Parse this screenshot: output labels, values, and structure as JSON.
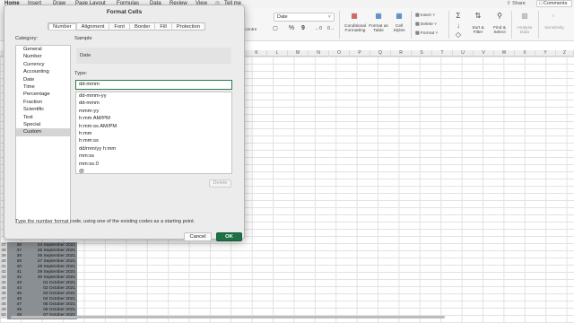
{
  "ribbon_tabs": [
    "Home",
    "Insert",
    "Draw",
    "Page Layout",
    "Formulas",
    "Data",
    "Review",
    "View",
    "Tell me"
  ],
  "ribbon_right": {
    "share": "Share",
    "comments": "Comments"
  },
  "ribbon": {
    "number_format_value": "Date",
    "centre_label": "Centre",
    "percent": "%",
    "comma": "9",
    "conditional_formatting": "Conditional Formatting",
    "format_as_table": "Format as Table",
    "cell_styles": "Cell Styles",
    "insert": "Insert",
    "delete": "Delete",
    "format": "Format",
    "sort_filter": "Sort & Filter",
    "find_select": "Find & Select",
    "analyse_data": "Analyse Data",
    "sensitivity": "Sensitivity"
  },
  "column_headers": [
    "I",
    "J",
    "K",
    "L",
    "M",
    "N",
    "O",
    "P",
    "Q",
    "R",
    "S",
    "T",
    "U",
    "V",
    "W",
    "X",
    "Y",
    "Z"
  ],
  "rows": [
    {
      "num": "37",
      "idx": "36",
      "date": "24 September 2021"
    },
    {
      "num": "38",
      "idx": "37",
      "date": "25 September 2021"
    },
    {
      "num": "39",
      "idx": "38",
      "date": "26 September 2021"
    },
    {
      "num": "40",
      "idx": "39",
      "date": "27 September 2021"
    },
    {
      "num": "41",
      "idx": "40",
      "date": "28 September 2021"
    },
    {
      "num": "42",
      "idx": "41",
      "date": "29 September 2021"
    },
    {
      "num": "43",
      "idx": "42",
      "date": "30 September 2021"
    },
    {
      "num": "44",
      "idx": "43",
      "date": "01 October 2021"
    },
    {
      "num": "45",
      "idx": "44",
      "date": "02 October 2021"
    },
    {
      "num": "46",
      "idx": "45",
      "date": "03 October 2021"
    },
    {
      "num": "47",
      "idx": "46",
      "date": "04 October 2021"
    },
    {
      "num": "48",
      "idx": "47",
      "date": "05 October 2021"
    },
    {
      "num": "49",
      "idx": "48",
      "date": "06 October 2021"
    },
    {
      "num": "50",
      "idx": "49",
      "date": "07 October 2021"
    }
  ],
  "dialog": {
    "title": "Format Cells",
    "tabs": [
      "Number",
      "Alignment",
      "Font",
      "Border",
      "Fill",
      "Protection"
    ],
    "active_tab": "Number",
    "category_label": "Category:",
    "categories": [
      "General",
      "Number",
      "Currency",
      "Accounting",
      "Date",
      "Time",
      "Percentage",
      "Fraction",
      "Scientific",
      "Text",
      "Special",
      "Custom"
    ],
    "selected_category": "Custom",
    "sample_label": "Sample",
    "sample_value": "Date",
    "type_label": "Type:",
    "type_value": "dd-mmm",
    "formats": [
      "dd-mmm-yy",
      "dd-mmm",
      "mmm-yy",
      "h:mm AM/PM",
      "h:mm:ss AM/PM",
      "h:mm",
      "h:mm:ss",
      "dd/mm/yy h:mm",
      "mm:ss",
      "mm:ss.0",
      "@"
    ],
    "delete_label": "Delete",
    "hint": "Type the number format code, using one of the existing codes as a starting point.",
    "cancel_label": "Cancel",
    "ok_label": "OK"
  }
}
